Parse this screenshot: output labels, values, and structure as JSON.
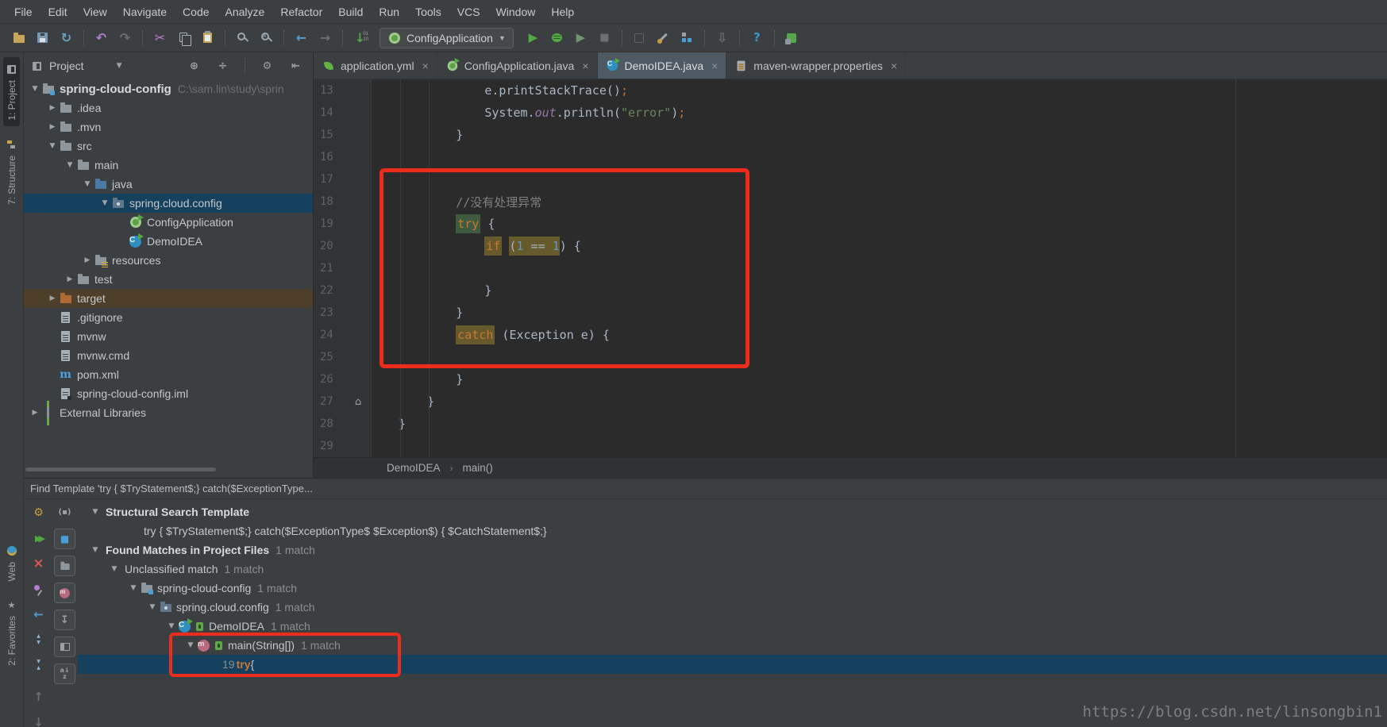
{
  "colors": {
    "panel_bg": "#3c3f41",
    "editor_bg": "#2b2b2b",
    "gutter_bg": "#313335",
    "text": "#bbbbbb",
    "code_text": "#a9b7c6",
    "line_number": "#606366",
    "selection": "#15415e",
    "target_row": "#4e3f2b",
    "keyword": "#cc7832",
    "string": "#6a8759",
    "number": "#6897bb",
    "comment": "#808080",
    "field": "#9876aa",
    "hl_olive": "#66592c",
    "hl_green": "#3e5b40",
    "annotation_red": "#ee2c1c",
    "tab_active": "#4e5a63",
    "count_gray": "#8a8f93",
    "path_gray": "#6b7074",
    "run_green": "#52a843",
    "watermark": "#7a7f82"
  },
  "menu_bar": {
    "items": [
      "File",
      "Edit",
      "View",
      "Navigate",
      "Code",
      "Analyze",
      "Refactor",
      "Build",
      "Run",
      "Tools",
      "VCS",
      "Window",
      "Help"
    ]
  },
  "toolbar": {
    "left_icons": [
      "open",
      "save",
      "sync",
      "|",
      "undo",
      "redo",
      "|",
      "cut",
      "copy",
      "paste",
      "|",
      "find",
      "replace",
      "|",
      "back",
      "forward",
      "|",
      "line-ops"
    ],
    "run_config": "ConfigApplication",
    "right_icons": [
      "run",
      "debug",
      "coverage",
      "stop",
      "|",
      "profile",
      "wrench",
      "structure-tb",
      "|",
      "download",
      "|",
      "help",
      "|",
      "plugin"
    ]
  },
  "activity_bar": {
    "top": [
      {
        "label": "1: Project",
        "icon": "stripe-project",
        "active": true
      },
      {
        "label": "7: Structure",
        "icon": "stripe-structure",
        "active": false
      }
    ],
    "bottom": [
      {
        "label": "Web",
        "icon": "stripe-web",
        "active": false
      },
      {
        "label": "2: Favorites",
        "icon": "stripe-favorites",
        "active": false
      }
    ]
  },
  "project_panel": {
    "title": "Project",
    "header_icons": [
      "locate",
      "divide",
      "|",
      "gear",
      "hide"
    ],
    "tree": [
      {
        "lvl": 0,
        "arrow": "down",
        "icon": "project-folder",
        "label": "spring-cloud-config",
        "bold": true,
        "path": "C:\\sam.lin\\study\\sprin"
      },
      {
        "lvl": 1,
        "arrow": "right",
        "icon": "folder",
        "label": ".idea"
      },
      {
        "lvl": 1,
        "arrow": "right",
        "icon": "folder",
        "label": ".mvn"
      },
      {
        "lvl": 1,
        "arrow": "down",
        "icon": "folder",
        "label": "src"
      },
      {
        "lvl": 2,
        "arrow": "down",
        "icon": "folder",
        "label": "main"
      },
      {
        "lvl": 3,
        "arrow": "down",
        "icon": "folder-blue",
        "label": "java"
      },
      {
        "lvl": 4,
        "arrow": "down",
        "icon": "package",
        "label": "spring.cloud.config",
        "selected": true
      },
      {
        "lvl": 5,
        "icon": "spring-class",
        "label": "ConfigApplication"
      },
      {
        "lvl": 5,
        "icon": "class-run",
        "label": "DemoIDEA"
      },
      {
        "lvl": 3,
        "arrow": "right",
        "icon": "folder-resources",
        "label": "resources"
      },
      {
        "lvl": 2,
        "arrow": "right",
        "icon": "folder",
        "label": "test"
      },
      {
        "lvl": 1,
        "arrow": "right",
        "icon": "folder-orange",
        "label": "target",
        "rowbg": "target"
      },
      {
        "lvl": 1,
        "icon": "file",
        "label": ".gitignore"
      },
      {
        "lvl": 1,
        "icon": "file",
        "label": "mvnw"
      },
      {
        "lvl": 1,
        "icon": "file",
        "label": "mvnw.cmd"
      },
      {
        "lvl": 1,
        "icon": "maven",
        "label": "pom.xml"
      },
      {
        "lvl": 1,
        "icon": "iml",
        "label": "spring-cloud-config.iml"
      },
      {
        "lvl": 0,
        "arrow": "right",
        "icon": "libs",
        "label": "External Libraries"
      }
    ]
  },
  "editor": {
    "tabs": [
      {
        "label": "application.yml",
        "icon": "spring-leaf",
        "active": false
      },
      {
        "label": "ConfigApplication.java",
        "icon": "spring-class",
        "active": false
      },
      {
        "label": "DemoIDEA.java",
        "icon": "class-run",
        "active": true
      },
      {
        "label": "maven-wrapper.properties",
        "icon": "properties",
        "active": false
      }
    ],
    "breadcrumbs": [
      "DemoIDEA",
      "main()"
    ],
    "lines": [
      {
        "n": "13",
        "seg": [
          [
            "p",
            "            e.printStackTrace()"
          ],
          [
            "k",
            ";"
          ]
        ]
      },
      {
        "n": "14",
        "seg": [
          [
            "p",
            "            System."
          ],
          [
            "f",
            "out"
          ],
          [
            "p",
            ".println("
          ],
          [
            "s",
            "\"error\""
          ],
          [
            "p",
            ")"
          ],
          [
            "k",
            ";"
          ]
        ]
      },
      {
        "n": "15",
        "seg": [
          [
            "p",
            "        }"
          ]
        ]
      },
      {
        "n": "16",
        "seg": []
      },
      {
        "n": "17",
        "seg": []
      },
      {
        "n": "18",
        "seg": [
          [
            "p",
            "        "
          ],
          [
            "c",
            "//没有处理异常"
          ]
        ]
      },
      {
        "n": "19",
        "seg": [
          [
            "p",
            "        "
          ],
          [
            "kg",
            "try"
          ],
          [
            "p",
            " {"
          ]
        ]
      },
      {
        "n": "20",
        "seg": [
          [
            "p",
            "            "
          ],
          [
            "kh",
            "if"
          ],
          [
            "p",
            " "
          ],
          [
            "hl",
            "("
          ],
          [
            "nh",
            "1"
          ],
          [
            "hl",
            " == "
          ],
          [
            "nh",
            "1"
          ],
          [
            "p",
            ") {"
          ]
        ]
      },
      {
        "n": "21",
        "seg": []
      },
      {
        "n": "22",
        "seg": [
          [
            "p",
            "            }"
          ]
        ]
      },
      {
        "n": "23",
        "seg": [
          [
            "p",
            "        }"
          ]
        ]
      },
      {
        "n": "24",
        "seg": [
          [
            "p",
            "        "
          ],
          [
            "kh",
            "catch"
          ],
          [
            "p",
            " (Exception e) {"
          ]
        ]
      },
      {
        "n": "25",
        "seg": []
      },
      {
        "n": "26",
        "seg": [
          [
            "p",
            "        }"
          ]
        ]
      },
      {
        "n": "27",
        "seg": [
          [
            "p",
            "    }"
          ]
        ],
        "fold": true
      },
      {
        "n": "28",
        "seg": [
          [
            "p",
            "}"
          ]
        ]
      },
      {
        "n": "29",
        "seg": []
      }
    ]
  },
  "find_panel": {
    "title": "Find Template 'try {  $TryStatement$;} catch($ExceptionType...",
    "toolbar_left": [
      "bp-settings",
      "bp-rerun",
      "bp-close",
      "bp-pin",
      "bp-back",
      "bp-expand",
      "bp-collapse",
      "spacer",
      "bp-up",
      "bp-down"
    ],
    "toolbar_right": [
      "bp-preview",
      "bp-box-blue",
      "bp-box-folder",
      "bp-box-module",
      "bp-box-export",
      "bp-box-layout",
      "bp-box-sort"
    ],
    "tree": [
      {
        "lvl": 0,
        "arrow": "down",
        "label": "Structural Search Template",
        "bold": true
      },
      {
        "lvl": 2,
        "label": "try {  $TryStatement$;} catch($ExceptionType$ $Exception$) {  $CatchStatement$;}"
      },
      {
        "lvl": 0,
        "arrow": "down",
        "label": "Found Matches in Project Files",
        "bold": true,
        "count": "1 match"
      },
      {
        "lvl": 1,
        "arrow": "down",
        "label": "Unclassified match",
        "count": "1 match"
      },
      {
        "lvl": 2,
        "arrow": "down",
        "icon": "project-folder",
        "label": "spring-cloud-config",
        "count": "1 match"
      },
      {
        "lvl": 3,
        "arrow": "down",
        "icon": "package",
        "label": "spring.cloud.config",
        "count": "1 match"
      },
      {
        "lvl": 4,
        "arrow": "down",
        "icon": "class-run",
        "lock": true,
        "label": "DemoIDEA",
        "count": "1 match"
      },
      {
        "lvl": 5,
        "arrow": "down",
        "icon": "method",
        "lock": true,
        "label": "main(String[])",
        "count": "1 match"
      },
      {
        "lvl": 7,
        "selected": true,
        "seg": [
          [
            "ln",
            "19 "
          ],
          [
            "kw",
            "try"
          ],
          [
            "pl",
            " {"
          ]
        ]
      }
    ]
  },
  "watermark": "https://blog.csdn.net/linsongbin1"
}
